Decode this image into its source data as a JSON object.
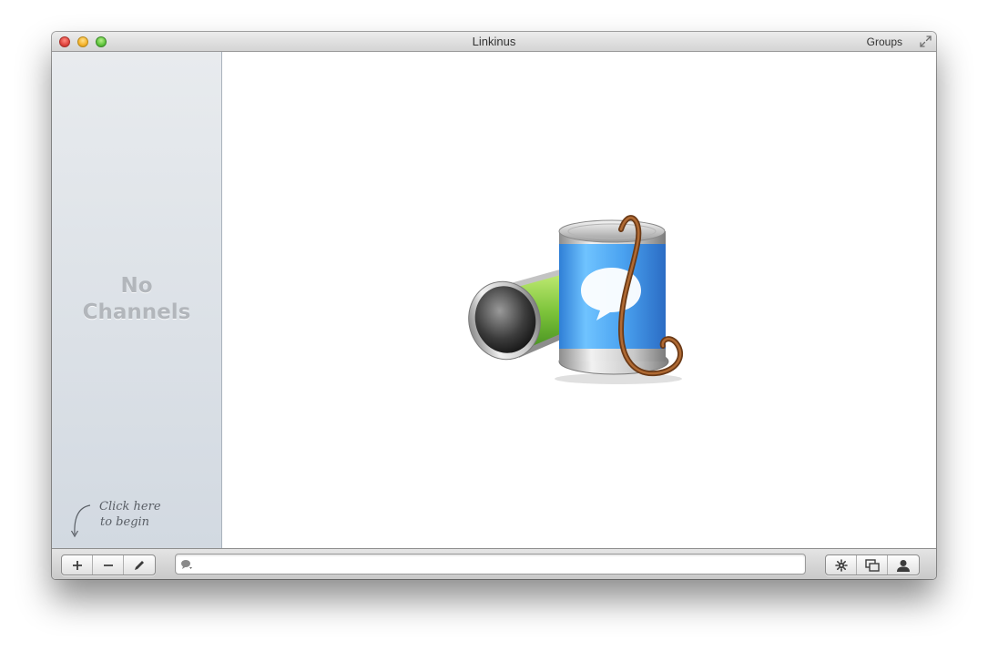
{
  "window": {
    "title": "Linkinus",
    "groups_label": "Groups"
  },
  "sidebar": {
    "empty_line1": "No",
    "empty_line2": "Channels",
    "hint_line1": "Click here",
    "hint_line2": "to begin"
  },
  "toolbar": {
    "left_buttons": [
      "add-icon",
      "remove-icon",
      "pencil-icon"
    ],
    "right_buttons": [
      "gear-icon",
      "windows-icon",
      "user-icon"
    ],
    "message_placeholder": ""
  },
  "colors": {
    "sidebar_top": "#e8ebee",
    "sidebar_bottom": "#d2d9e1",
    "close": "#e0443e",
    "minimize": "#f5b32b",
    "zoom": "#5fc43c"
  }
}
